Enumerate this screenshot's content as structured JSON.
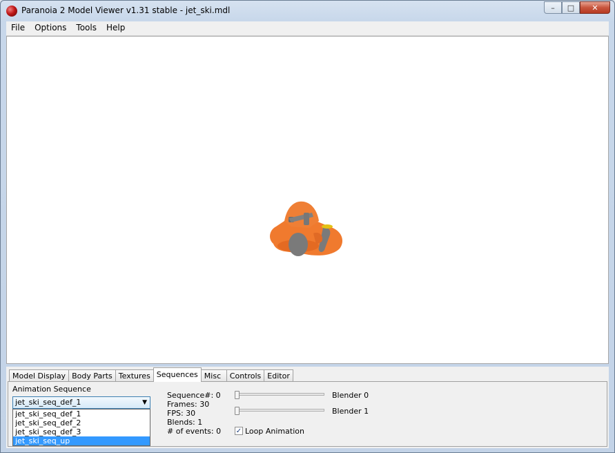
{
  "window": {
    "title": "Paranoia 2 Model Viewer v1.31 stable - jet_ski.mdl"
  },
  "caption_buttons": {
    "minimize": "–",
    "maximize": "□",
    "close": "✕"
  },
  "menu": [
    "File",
    "Options",
    "Tools",
    "Help"
  ],
  "tabs": [
    "Model Display",
    "Body Parts",
    "Textures",
    "Sequences",
    "Misc",
    "Controls",
    "Editor"
  ],
  "active_tab": "Sequences",
  "sequences_panel": {
    "animation_sequence_label": "Animation Sequence",
    "selected_sequence": "jet_ski_seq_def_1",
    "sequence_options": [
      "jet_ski_seq_def_1",
      "jet_ski_seq_def_2",
      "jet_ski_seq_def_3",
      "jet_ski_seq_up"
    ],
    "highlighted_option": "jet_ski_seq_up",
    "info": {
      "sequence_number": "Sequence#: 0",
      "frames": "Frames: 30",
      "fps": "FPS: 30",
      "blends": "Blends: 1",
      "events": "# of events: 0"
    },
    "blender_0_label": "Blender 0",
    "blender_1_label": "Blender 1",
    "blender_0_value": 0,
    "blender_1_value": 0,
    "loop_animation_label": "Loop Animation",
    "loop_animation_checked": true
  },
  "colors": {
    "model_body": "#f07a2e",
    "model_gray": "#7a7a7a",
    "selection": "#3399ff"
  }
}
